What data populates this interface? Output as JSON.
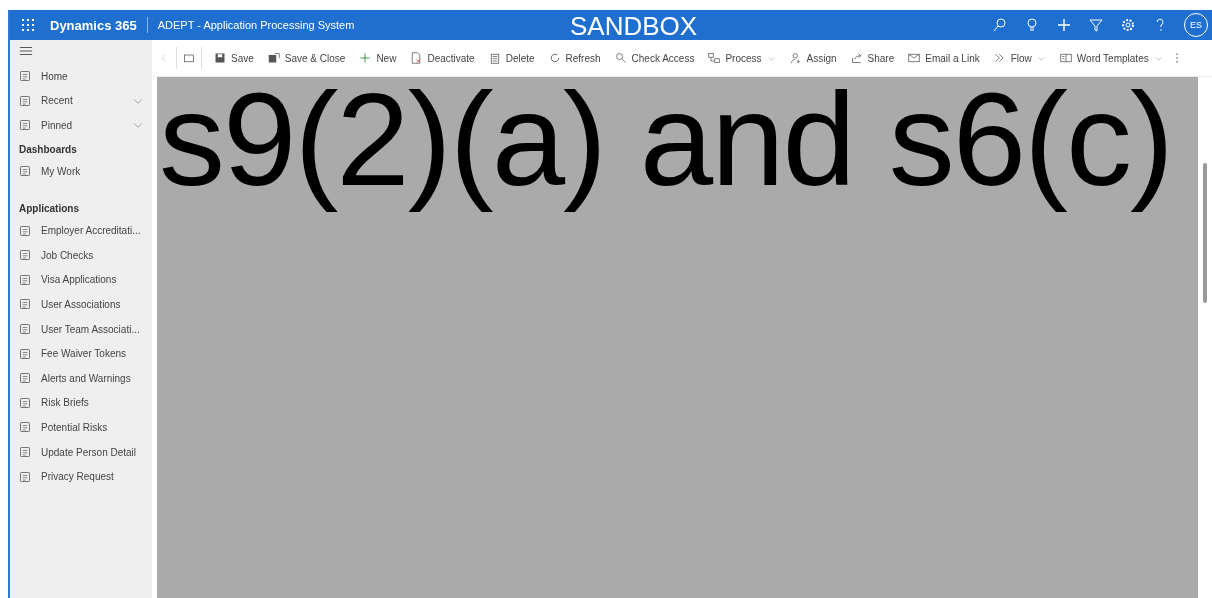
{
  "header": {
    "app_name": "Dynamics 365",
    "app_title": "ADEPT - Application Processing System",
    "environment": "SANDBOX",
    "avatar": "ES"
  },
  "command_bar": [
    {
      "label": "Save",
      "dropdown": false
    },
    {
      "label": "Save & Close",
      "dropdown": false
    },
    {
      "label": "New",
      "dropdown": false
    },
    {
      "label": "Deactivate",
      "dropdown": false
    },
    {
      "label": "Delete",
      "dropdown": false
    },
    {
      "label": "Refresh",
      "dropdown": false
    },
    {
      "label": "Check Access",
      "dropdown": false
    },
    {
      "label": "Process",
      "dropdown": true
    },
    {
      "label": "Assign",
      "dropdown": false
    },
    {
      "label": "Share",
      "dropdown": false
    },
    {
      "label": "Email a Link",
      "dropdown": false
    },
    {
      "label": "Flow",
      "dropdown": true
    },
    {
      "label": "Word Templates",
      "dropdown": true
    }
  ],
  "sidebar": {
    "top_items": [
      {
        "label": "Home",
        "expandable": false
      },
      {
        "label": "Recent",
        "expandable": true
      },
      {
        "label": "Pinned",
        "expandable": true
      }
    ],
    "groups": [
      {
        "title": "Dashboards",
        "items": [
          "My Work"
        ]
      },
      {
        "title": "Applications",
        "items": [
          "Employer Accreditati...",
          "Job Checks",
          "Visa Applications",
          "User Associations",
          "User Team Associati...",
          "Fee Waiver Tokens",
          "Alerts and Warnings",
          "Risk Briefs",
          "Potential Risks",
          "Update Person Detail",
          "Privacy Request"
        ]
      }
    ]
  },
  "redaction": {
    "label": "s9(2)(a) and s6(c)"
  }
}
